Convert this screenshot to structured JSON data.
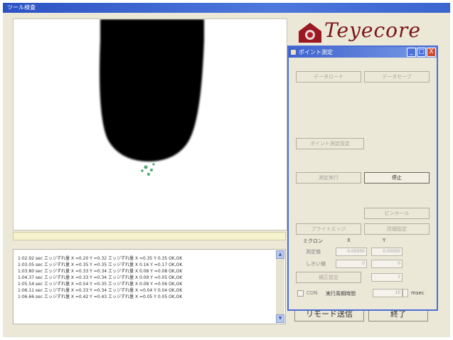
{
  "window": {
    "title": "ツール検査"
  },
  "camera": {
    "description_color": "#000000"
  },
  "log": {
    "lines": [
      "1:02.92 sec エッジずれ量 X =0.20 Y =0.32 エッジずれ量 X =0.35 Y 0.35 OK,OK",
      "1:03.05 sec エッジずれ量 X =0.35 Y =0.35 エッジずれ量 X 0.16 Y =0.17 OK,OK",
      "1:03.80 sec エッジずれ量 X =0.33 Y =0.34 エッジずれ量 X 0.08 Y =0.08 OK,OK",
      "1:04.37 sec エッジずれ量 X =0.33 Y =0.34 エッジずれ量 X 0.09 Y =0.05 OK,OK",
      "1:05.54 sec エッジずれ量 X =0.54 Y =0.35 エッジずれ量 X 0.08 Y =0.06 OK,OK",
      "1:06.11 sec エッジずれ量 X =0.33 Y =0.34 エッジずれ量 X =0.04 Y 0.04 OK,OK",
      "1:06.66 sec エッジずれ量 X =0.42 Y =0.43 エッジずれ量 X =0.05 Y 0.05 OK,OK"
    ],
    "scroll_up": "▲",
    "scroll_down": "▼"
  },
  "logo": {
    "text": "Teyecore",
    "brand_color": "#7a1416",
    "house_color": "#b41c24"
  },
  "background_buttons": {
    "remote_send": "リモード送信",
    "end": "終了"
  },
  "dialog": {
    "title": "ポイント測定",
    "minimize": "_",
    "maximize": "□",
    "close": "X",
    "data_load": "データロード",
    "data_save": "データセーブ",
    "point_setting": "ポイント測定設定",
    "measure_run": "測定実行",
    "stop": "停止",
    "btn_right1": "ピンホール",
    "btn_left2": "ブライトエッジ",
    "btn_right2": "詳細設定",
    "micron_label": "ミクロン",
    "x_header": "X",
    "y_header": "Y",
    "measured_label": "測定値",
    "measured_x": "0.00000",
    "measured_y": "0.00000",
    "shift_label": "しきい値",
    "shift_x": "0",
    "shift_y": "0",
    "correction_btn": "補正設定",
    "correction_value": "1",
    "checkbox_label": "CON",
    "interval_label": "実行周期時間",
    "interval_value": "10",
    "interval_unit": "msec"
  }
}
